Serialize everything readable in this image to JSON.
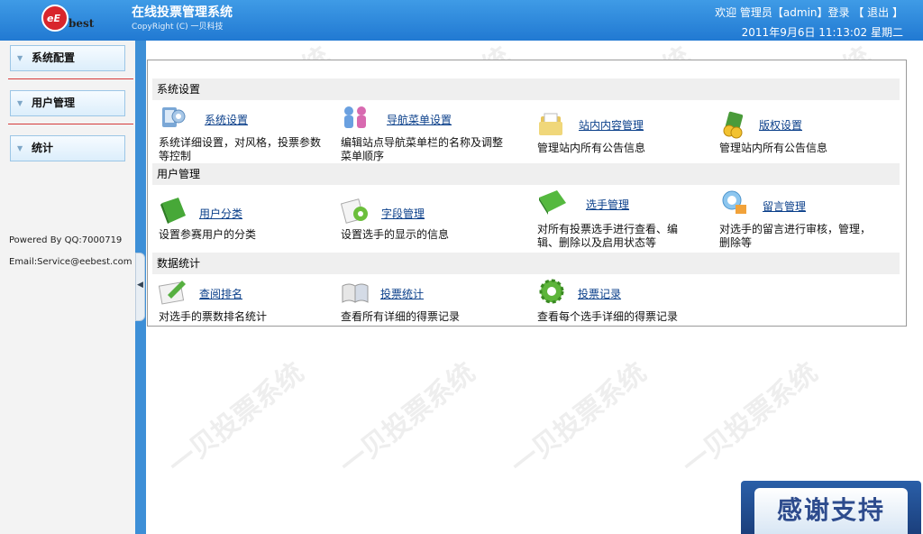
{
  "header": {
    "logo_mark": "eE",
    "logo_text": "best",
    "app_title": "在线投票管理系统",
    "copyright": "CopyRight (C) 一贝科技",
    "welcome": "欢迎",
    "user": "管理员【admin】登录",
    "logout": "【 退出 】",
    "datetime": "2011年9月6日 11:13:02 星期二"
  },
  "sidebar": {
    "items": [
      {
        "label": "系统配置"
      },
      {
        "label": "用户管理"
      },
      {
        "label": "统计"
      }
    ],
    "powered": "Powered By QQ:7000719",
    "email": "Email:Service@eebest.com"
  },
  "sections": [
    {
      "title": "系统设置",
      "items": [
        {
          "label": "系统设置",
          "desc": "系统详细设置，对风格，投票参数等控制",
          "icon": "settings-icon"
        },
        {
          "label": "导航菜单设置",
          "desc": "编辑站点导航菜单栏的名称及调整菜单顺序",
          "icon": "users-icon"
        },
        {
          "label": "站内内容管理",
          "desc": "管理站内所有公告信息",
          "icon": "folder-icon"
        },
        {
          "label": "版权设置",
          "desc": "管理站内所有公告信息",
          "icon": "coins-icon"
        }
      ]
    },
    {
      "title": "用户管理",
      "items": [
        {
          "label": "用户分类",
          "desc": "设置参赛用户的分类",
          "icon": "book-icon"
        },
        {
          "label": "字段管理",
          "desc": "设置选手的显示的信息",
          "icon": "gear-doc-icon"
        },
        {
          "label": "选手管理",
          "desc": "对所有投票选手进行查看、编辑、删除以及启用状态等",
          "icon": "book-icon"
        },
        {
          "label": "留言管理",
          "desc": "对选手的留言进行审核，管理，删除等",
          "icon": "message-icon"
        }
      ]
    },
    {
      "title": "数据统计",
      "items": [
        {
          "label": "查阅排名",
          "desc": "对选手的票数排名统计",
          "icon": "edit-icon"
        },
        {
          "label": "投票统计",
          "desc": "查看所有详细的得票记录",
          "icon": "open-book-icon"
        },
        {
          "label": "投票记录",
          "desc": "查看每个选手详细的得票记录",
          "icon": "gear-icon"
        }
      ]
    }
  ],
  "watermark": "一贝投票系统",
  "thanks": "感谢支持",
  "colors": {
    "header": "#2f8ade",
    "link": "#0a3f8a",
    "accent": "#d63a3a"
  }
}
